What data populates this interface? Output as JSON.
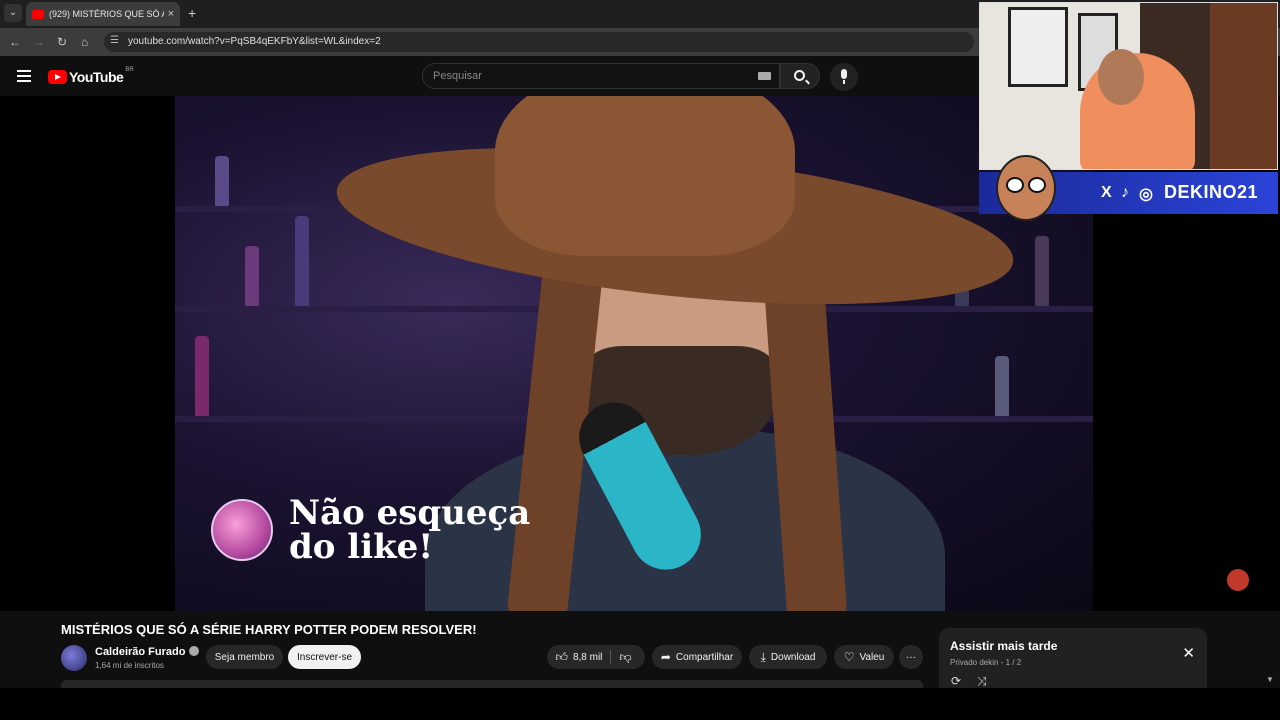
{
  "browser": {
    "tab_title": "(929) MISTÉRIOS QUE SÓ A SÉRIE",
    "tab_close": "×",
    "new_tab": "+",
    "url": "youtube.com/watch?v=PqSB4qEKFbY&list=WL&index=2"
  },
  "header": {
    "logo_text": "YouTube",
    "region": "BR",
    "search_placeholder": "Pesquisar"
  },
  "video": {
    "overlay_text_line1": "Não esqueça",
    "overlay_text_line2": "do like!",
    "social_handle": "DEKINO21",
    "social_icons": [
      "X",
      "♪",
      "◎"
    ]
  },
  "meta": {
    "title": "MISTÉRIOS QUE SÓ A SÉRIE HARRY POTTER PODEM RESOLVER!",
    "channel_name": "Caldeirão Furado",
    "subscribers": "1,64 mi de inscritos",
    "join_label": "Seja membro",
    "subscribe_label": "Inscrever-se",
    "likes": "8,8 mil",
    "share_label": "Compartilhar",
    "download_label": "Download",
    "thanks_label": "Valeu",
    "more_label": "···"
  },
  "watch_later": {
    "title": "Assistir mais tarde",
    "meta": "Privado dekin - 1 / 2",
    "close": "✕"
  },
  "colors": {
    "accent": "#ff0000",
    "background": "#0f0f0f",
    "social_banner": "#2b44d8"
  }
}
